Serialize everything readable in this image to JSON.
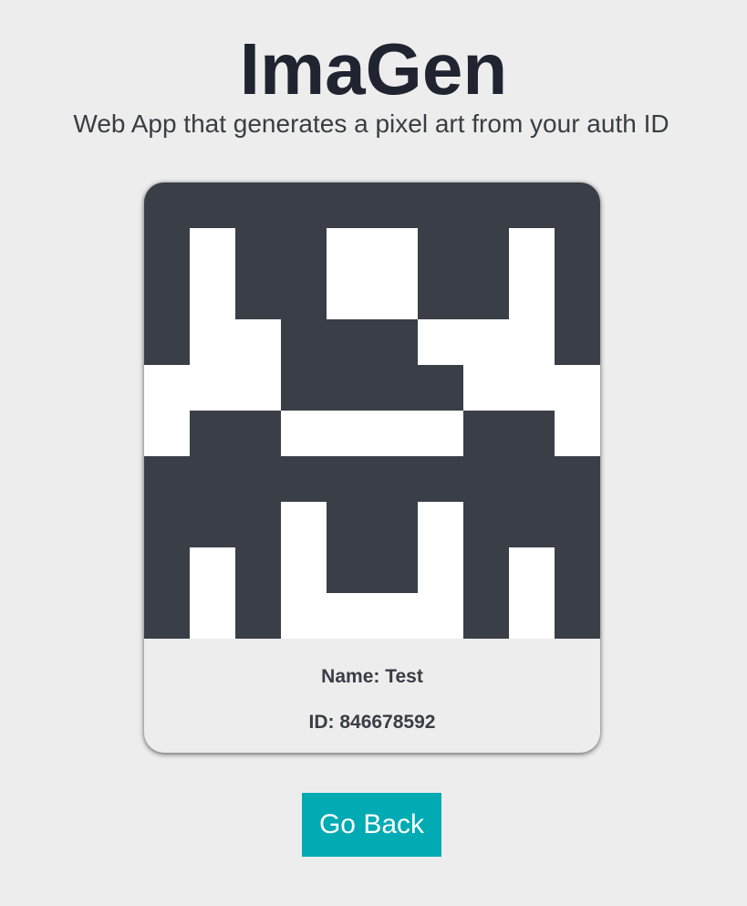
{
  "header": {
    "title": "ImaGen",
    "subtitle": "Web App that generates a pixel art from your auth ID"
  },
  "card": {
    "name_text": "Name: Test",
    "id_text": "ID: 846678592",
    "pixel_art": {
      "dark_color": "#3a3e47",
      "light_color": "#ffffff",
      "rows": [
        "0000000000",
        "0100110010",
        "0100110010",
        "0110001110",
        "1110000111",
        "1001111001",
        "0000000000",
        "0001001000",
        "0101001010",
        "0101111010"
      ]
    }
  },
  "actions": {
    "back_label": "Go Back"
  },
  "colors": {
    "background": "#ededed",
    "title": "#1f2430",
    "button": "#00abb4",
    "button_text": "#ffffff"
  }
}
